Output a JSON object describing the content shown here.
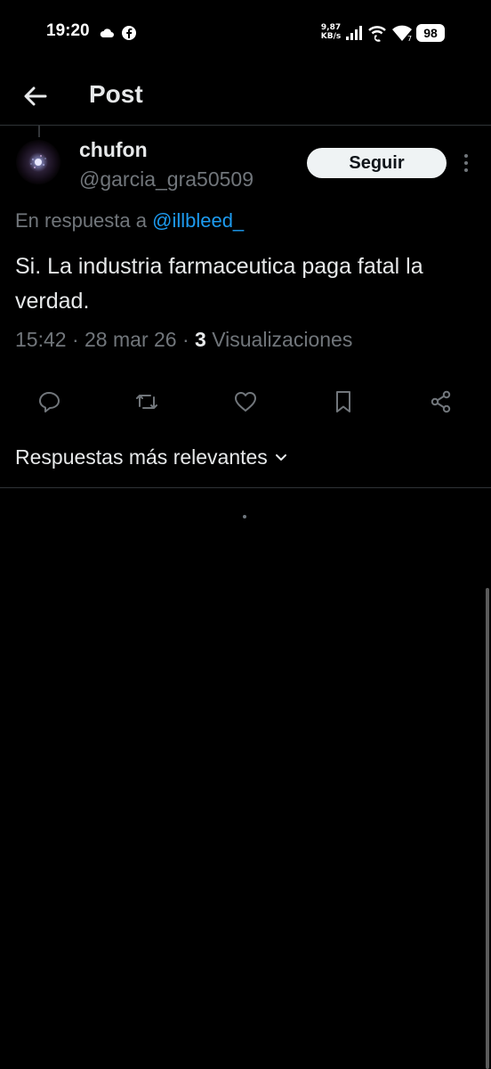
{
  "status_bar": {
    "time": "19:20",
    "net_speed_value": "9,87",
    "net_speed_unit": "KB/s",
    "battery": "98"
  },
  "header": {
    "title": "Post"
  },
  "post": {
    "author_name": "chufon",
    "author_handle": "@garcia_gra50509",
    "follow_label": "Seguir",
    "reply_prefix": "En respuesta a",
    "reply_handle": "@illbleed_",
    "text": "Si. La industria farmaceutica paga fatal la verdad.",
    "time": "15:42",
    "date": "28 mar 26",
    "views_count": "3",
    "views_label": "Visualizaciones"
  },
  "replies": {
    "sort_label": "Respuestas más relevantes"
  },
  "colors": {
    "background": "#000000",
    "text_primary": "#e7e9ea",
    "text_secondary": "#71767b",
    "link": "#1d9bf0",
    "divider": "#2f3336"
  }
}
